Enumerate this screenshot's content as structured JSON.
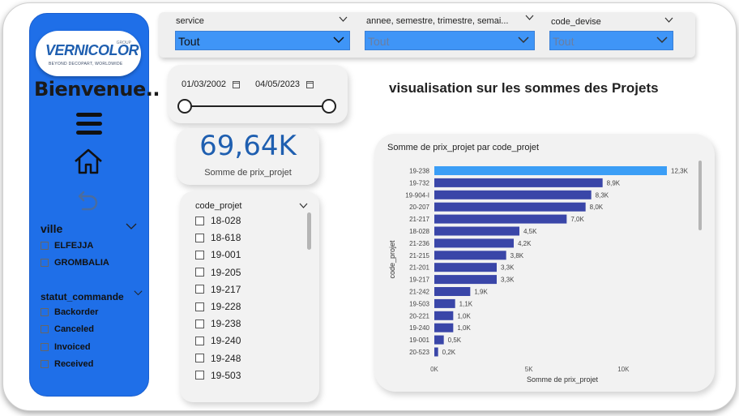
{
  "brand": {
    "logo_text": "VERNICOLOR",
    "logo_group": "GROUP",
    "logo_tagline": "BEYOND DECOPART, WORLDWIDE"
  },
  "sidebar": {
    "welcome": "Bienvenue..",
    "icons": [
      "menu-icon",
      "home-icon",
      "back-icon"
    ],
    "ville": {
      "title": "ville",
      "items": [
        "ELFEJJA",
        "GROMBALIA"
      ]
    },
    "statut": {
      "title": "statut_commande",
      "items": [
        "Backorder",
        "Canceled",
        "Invoiced",
        "Received"
      ]
    }
  },
  "filters": [
    {
      "label": "service",
      "value": "Tout",
      "active": true
    },
    {
      "label": "annee, semestre, trimestre, semai...",
      "value": "Tout",
      "active": false
    },
    {
      "label": "code_devise",
      "value": "Tout",
      "active": false
    }
  ],
  "date_range": {
    "start": "01/03/2002",
    "end": "04/05/2023"
  },
  "kpi": {
    "value": "69,64K",
    "label": "Somme de prix_projet"
  },
  "heading": "visualisation sur les sommes des Projets",
  "code_slicer": {
    "title": "code_projet",
    "items": [
      "18-028",
      "18-618",
      "19-001",
      "19-205",
      "19-217",
      "19-228",
      "19-238",
      "19-240",
      "19-248",
      "19-503"
    ]
  },
  "colors": {
    "accent": "#1f6fe8",
    "highlight_bar": "#3b9ef6",
    "bar": "#3a46a8",
    "kpi": "#1f5fb0"
  },
  "chart_data": {
    "type": "bar",
    "orientation": "horizontal",
    "title": "Somme de prix_projet par code_projet",
    "xlabel": "Somme de prix_projet",
    "ylabel": "code_projet",
    "xlim": [
      0,
      12300
    ],
    "xticks": [
      "0K",
      "5K",
      "10K"
    ],
    "xtick_values": [
      0,
      5000,
      10000
    ],
    "categories": [
      "19-238",
      "19-732",
      "19-904-I",
      "20-207",
      "21-217",
      "18-028",
      "21-236",
      "21-215",
      "21-201",
      "19-217",
      "21-242",
      "19-503",
      "20-221",
      "19-240",
      "19-001",
      "20-523"
    ],
    "values": [
      12300,
      8900,
      8300,
      8000,
      7000,
      4500,
      4200,
      3800,
      3300,
      3300,
      1900,
      1100,
      1000,
      1000,
      500,
      200
    ],
    "labels": [
      "12,3K",
      "8,9K",
      "8,3K",
      "8,0K",
      "7,0K",
      "4,5K",
      "4,2K",
      "3,8K",
      "3,3K",
      "3,3K",
      "1,9K",
      "1,1K",
      "1,0K",
      "1,0K",
      "0,5K",
      "0,2K"
    ],
    "highlighted_index": 0
  }
}
